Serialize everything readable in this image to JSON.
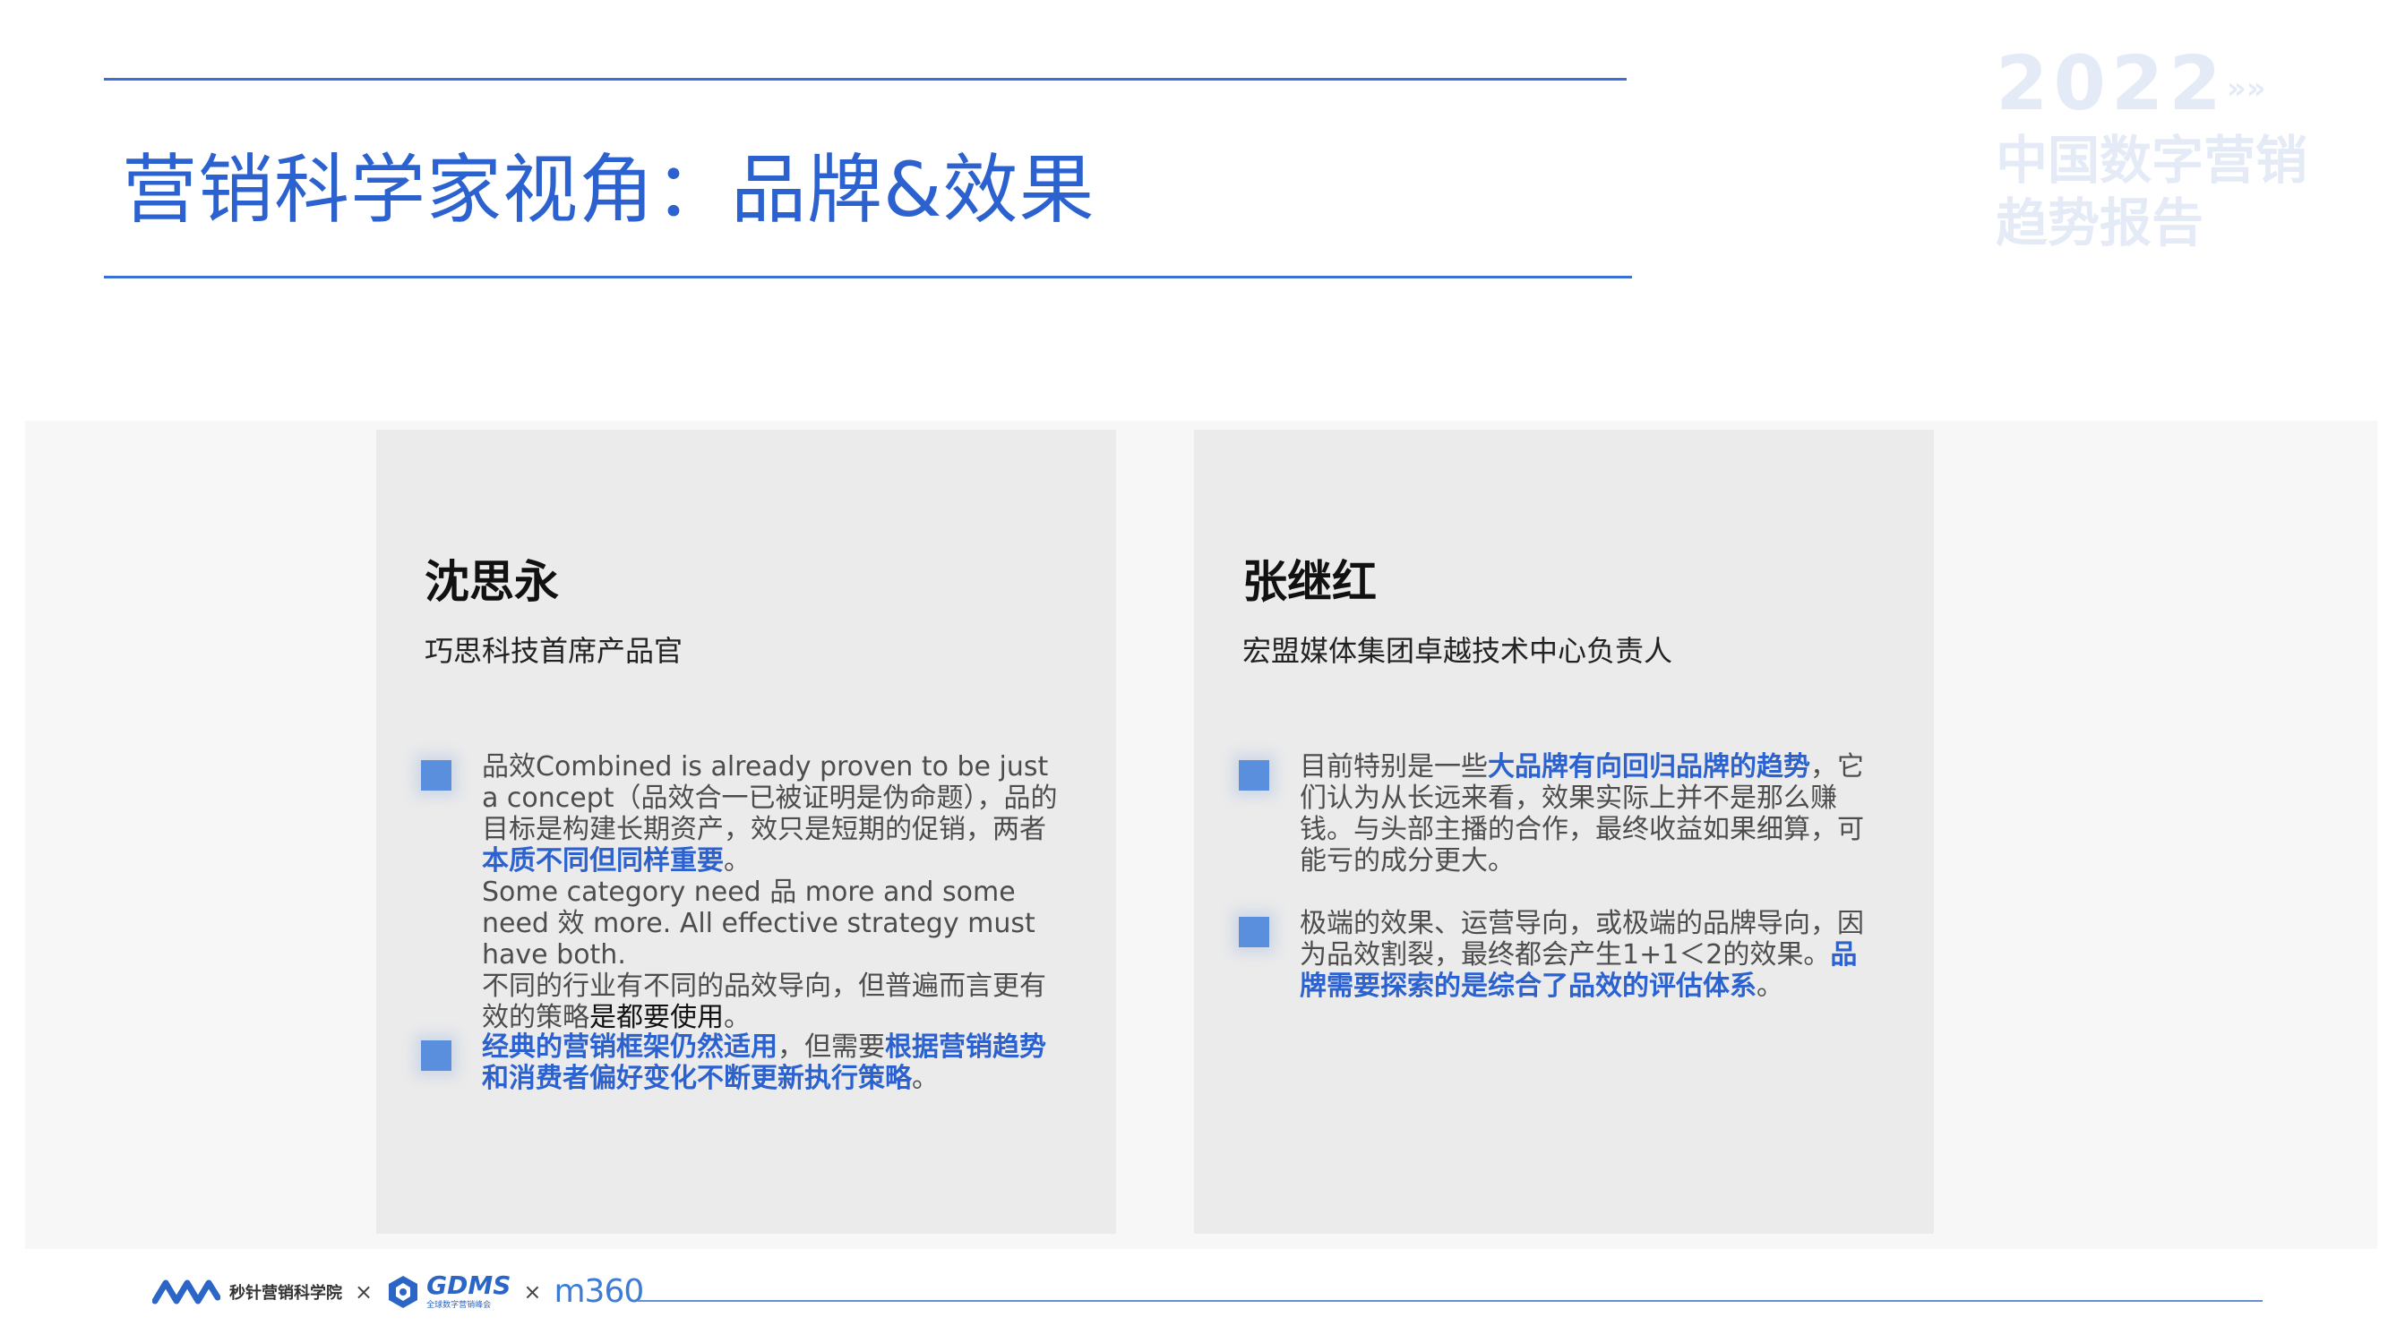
{
  "header": {
    "title": "营销科学家视角：品牌&效果",
    "watermark": {
      "year": "2022",
      "line1": "中国数字营销",
      "line2": "趋势报告"
    }
  },
  "cards": [
    {
      "name": "沈思永",
      "role": "巧思科技首席产品官",
      "bullets": [
        {
          "p1_a": "品效Combined is already proven to be just a concept（品效合一已被证明是伪命题），品的目标是构建长期资产，效只是短期的促销，两者",
          "p1_hl": "本质不同但同样重要",
          "p1_b": "。",
          "p2": "Some category need 品 more and some need 效 more.  All effective strategy must have both.",
          "p3_a": "不同的行业有不同的品效导向，但普遍而言更有效的策略",
          "p3_dk": "是都要使用",
          "p3_b": "。"
        },
        {
          "hl1": "经典的营销框架仍然适用",
          "mid": "，但需要",
          "hl2": "根据营销趋势和消费者偏好变化不断更新执行策略",
          "end": "。"
        }
      ]
    },
    {
      "name": "张继红",
      "role": "宏盟媒体集团卓越技术中心负责人",
      "bullets": [
        {
          "a": "目前特别是一些",
          "hl": "大品牌有向回归品牌的趋势",
          "b": "，它们认为从长远来看，效果实际上并不是那么赚钱。与头部主播的合作，最终收益如果细算，可能亏的成分更大。"
        },
        {
          "a": "极端的效果、运营导向，或极端的品牌导向，因为品效割裂，最终都会产生1+1＜2的效果。",
          "hl": "品牌需要探索的是综合了品效的评估体系",
          "b": "。"
        }
      ]
    }
  ],
  "footer": {
    "logo1_text": "秒针营销科学院",
    "x1": "×",
    "logo2_word": "GDMS",
    "logo2_sub": "全球数字营销峰会",
    "x2": "×",
    "logo3_text": "m360"
  },
  "colors": {
    "accent": "#2c62cf",
    "marker": "#5a8fde",
    "card_bg": "#ebebeb",
    "band_bg": "#f7f7f7"
  }
}
